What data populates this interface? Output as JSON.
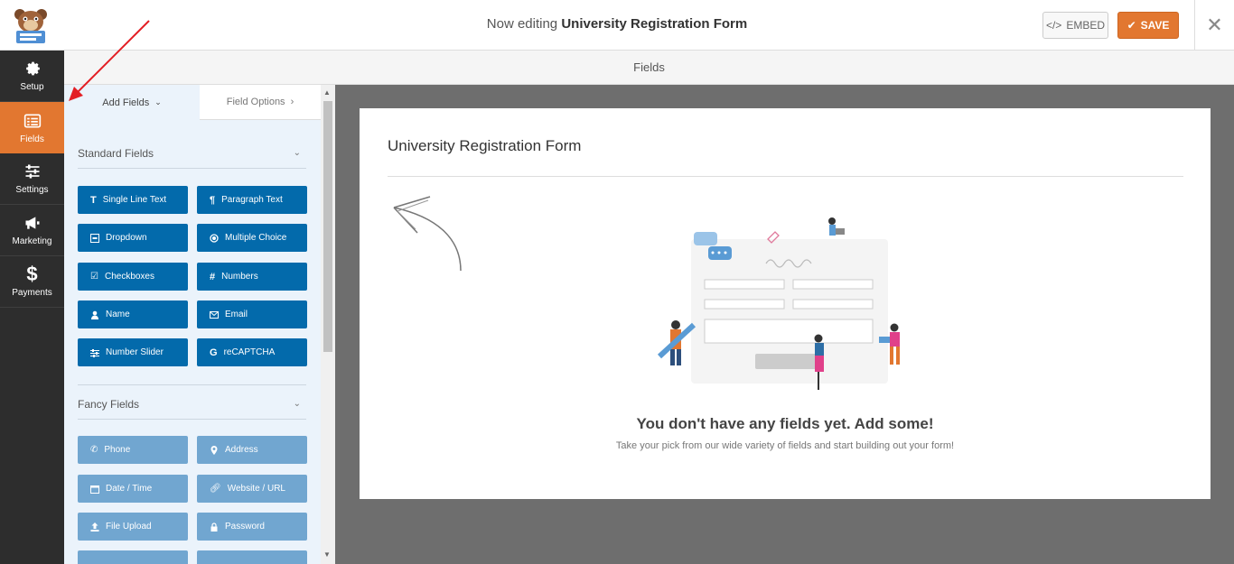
{
  "header": {
    "title_prefix": "Now editing",
    "form_name": "University Registration Form",
    "embed_label": "EMBED",
    "save_label": "SAVE",
    "brand_accent": "#e27730"
  },
  "nav": {
    "items": [
      {
        "label": "Setup",
        "icon": "gear-icon"
      },
      {
        "label": "Fields",
        "icon": "list-icon",
        "active": true
      },
      {
        "label": "Settings",
        "icon": "sliders-icon"
      },
      {
        "label": "Marketing",
        "icon": "megaphone-icon"
      },
      {
        "label": "Payments",
        "icon": "dollar-icon"
      }
    ]
  },
  "fields_header": "Fields",
  "panel": {
    "tabs": {
      "add_fields": "Add Fields",
      "field_options": "Field Options"
    },
    "standard_title": "Standard Fields",
    "standard_fields": [
      "Single Line Text",
      "Paragraph Text",
      "Dropdown",
      "Multiple Choice",
      "Checkboxes",
      "Numbers",
      "Name",
      "Email",
      "Number Slider",
      "reCAPTCHA"
    ],
    "fancy_title": "Fancy Fields",
    "fancy_fields": [
      "Phone",
      "Address",
      "Date / Time",
      "Website / URL",
      "File Upload",
      "Password"
    ]
  },
  "preview": {
    "form_title": "University Registration Form",
    "empty_heading": "You don't have any fields yet. Add some!",
    "empty_subtext": "Take your pick from our wide variety of fields and start building out your form!"
  }
}
